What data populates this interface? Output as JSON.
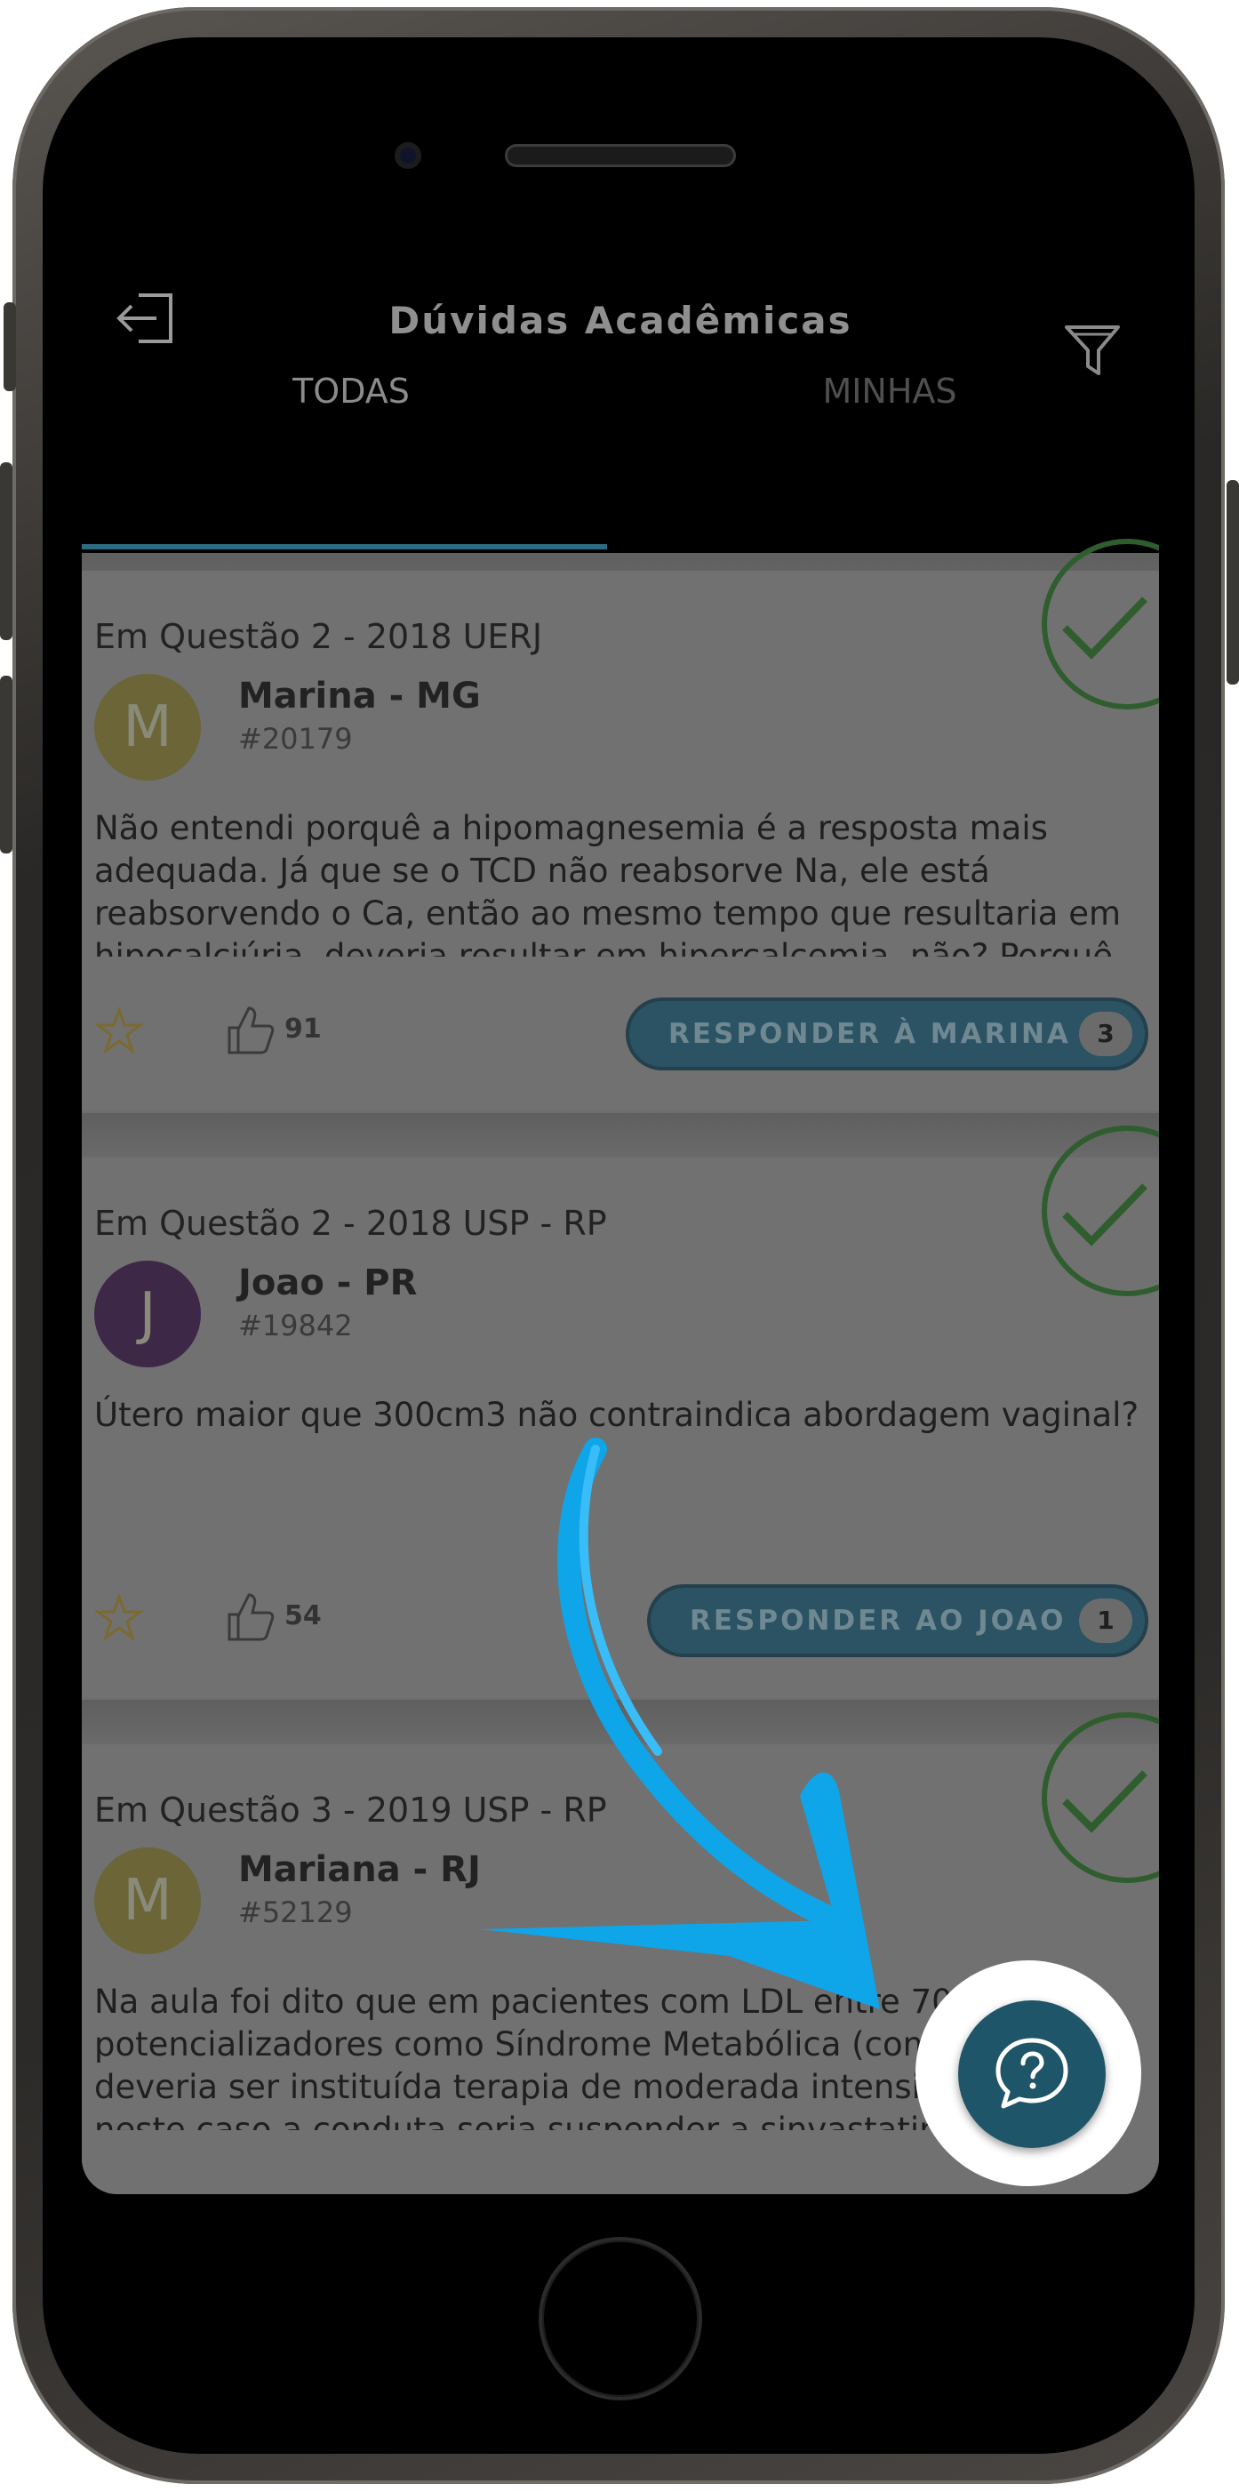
{
  "app": {
    "title": "Dúvidas Acadêmicas"
  },
  "tabs": [
    {
      "label": "TODAS",
      "active": true
    },
    {
      "label": "MINHAS",
      "active": false
    }
  ],
  "questions": [
    {
      "context": "Em Questão 2 - 2018 UERJ",
      "avatar_letter": "M",
      "avatar_color": "#6b6538",
      "author": "Marina - MG",
      "author_id": "#20179",
      "text": "Não entendi porquê a hipomagnesemia é a resposta mais adequada. Já que se o TCD não reabsorve Na, ele está reabsorvendo o Ca, então ao mesmo tempo que resultaria em hipocalciúria, deveria resultar em hipercalcemia, não? Porquê",
      "likes": "91",
      "reply_label": "RESPONDER À MARINA",
      "reply_count": "3",
      "resolved": true
    },
    {
      "context": "Em Questão 2 - 2018 USP - RP",
      "avatar_letter": "J",
      "avatar_color": "#3e2848",
      "author": "Joao - PR",
      "author_id": "#19842",
      "text": "Útero maior que 300cm3 não contraindica abordagem vaginal?",
      "likes": "54",
      "reply_label": "RESPONDER AO JOAO",
      "reply_count": "1",
      "resolved": true
    },
    {
      "context": "Em Questão 3 - 2019 USP - RP",
      "avatar_letter": "M",
      "avatar_color": "#6b6538",
      "author": "Mariana - RJ",
      "author_id": "#52129",
      "text": "Na aula foi dito que em pacientes com LDL entre 70-189 com potencializadores como Síndrome Metabólica (como caso), deveria ser instituída terapia de moderada intensidade. Porque neste caso a conduta seria suspender a sinvastatina?",
      "resolved": true
    }
  ],
  "icons": {
    "back": "exit-icon",
    "filter": "filter-icon",
    "star": "star-icon",
    "like": "thumbs-up-icon",
    "check": "check-circle-icon",
    "fab": "chat-question-icon",
    "arrow": "annotation-arrow"
  },
  "colors": {
    "accent": "#2e6b80",
    "fab": "#1e5568",
    "arrow": "#0ea5e9",
    "resolved": "#2f5d2e"
  }
}
